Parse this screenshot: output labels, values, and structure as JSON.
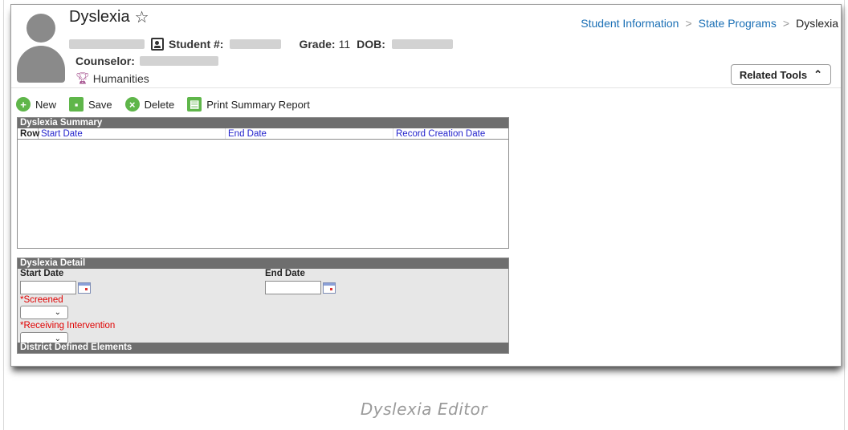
{
  "header": {
    "title": "Dyslexia",
    "student_number_label": "Student #:",
    "grade_label": "Grade:",
    "grade_value": "11",
    "dob_label": "DOB:",
    "counselor_label": "Counselor:",
    "house": "Humanities"
  },
  "breadcrumb": {
    "items": [
      "Student Information",
      "State Programs",
      "Dyslexia"
    ],
    "separator": ">"
  },
  "related_tools": {
    "label": "Related Tools"
  },
  "toolbar": {
    "new_label": "New",
    "save_label": "Save",
    "delete_label": "Delete",
    "print_label": "Print Summary Report"
  },
  "summary": {
    "title": "Dyslexia Summary",
    "columns": [
      "Row",
      "Start Date",
      "End Date",
      "Record Creation Date"
    ]
  },
  "detail": {
    "title": "Dyslexia Detail",
    "start_date_label": "Start Date",
    "end_date_label": "End Date",
    "screened_label": "*Screened",
    "intervention_label": "*Receiving Intervention",
    "district_label": "District Defined Elements"
  },
  "caption": "Dyslexia Editor",
  "colors": {
    "accent_green": "#5fb64a",
    "link_blue": "#1a6fb5",
    "section_gray": "#6e6e6e",
    "required_red": "#e00000",
    "trophy_purple": "#a24b8b"
  }
}
